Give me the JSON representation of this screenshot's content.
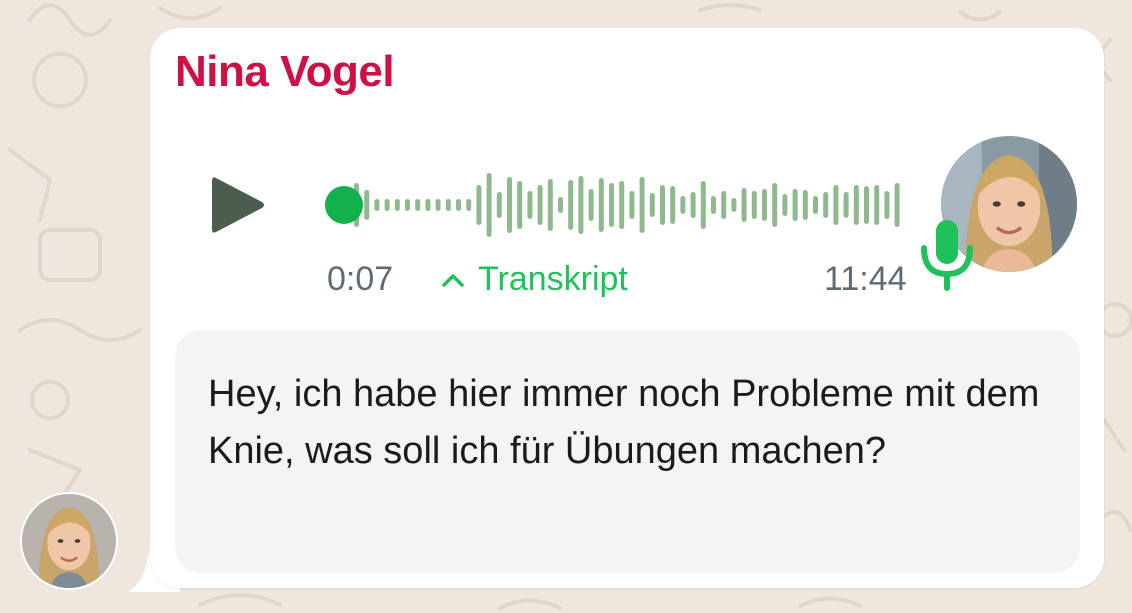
{
  "message": {
    "sender_name": "Nina Vogel",
    "time_elapsed": "0:07",
    "transcript_label": "Transkript",
    "time_sent": "11:44",
    "transcript_text": "Hey, ich habe hier immer noch Probleme mit dem Knie, was soll ich für Übungen machen?",
    "playback_progress": 0.03
  },
  "icons": {
    "play": "play-icon",
    "mic": "microphone-icon",
    "chevron": "chevron-up-icon"
  },
  "colors": {
    "sender_name": "#cc1145",
    "accent_green": "#1fc15a",
    "scrubber_dot": "#12b14c",
    "waveform": "#8fb88f",
    "play_button": "#4a5d4e",
    "chat_background": "#efe6dd"
  }
}
